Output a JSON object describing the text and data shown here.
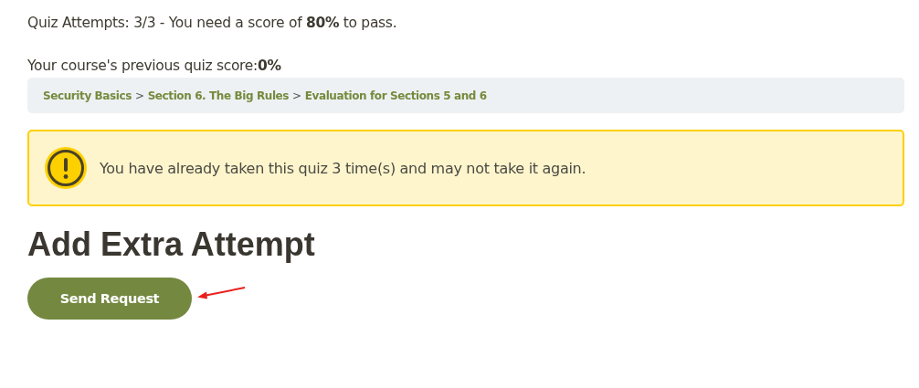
{
  "quiz_info": {
    "attempts_text": "Quiz Attempts: 3/3 - You need a score of **80%** to pass.",
    "previous_score_text": "Your course's previous quiz score:**0%**"
  },
  "breadcrumb": {
    "separator": ">",
    "items": [
      {
        "label": "Security Basics"
      },
      {
        "label": "Section 6. The Big Rules"
      },
      {
        "label": "Evaluation for Sections 5 and 6"
      }
    ]
  },
  "alert": {
    "kind": "warning",
    "message": "You have already taken this quiz 3 time(s) and may not take it again."
  },
  "extra_attempt": {
    "heading": "Add Extra Attempt",
    "button": "Send Request"
  }
}
